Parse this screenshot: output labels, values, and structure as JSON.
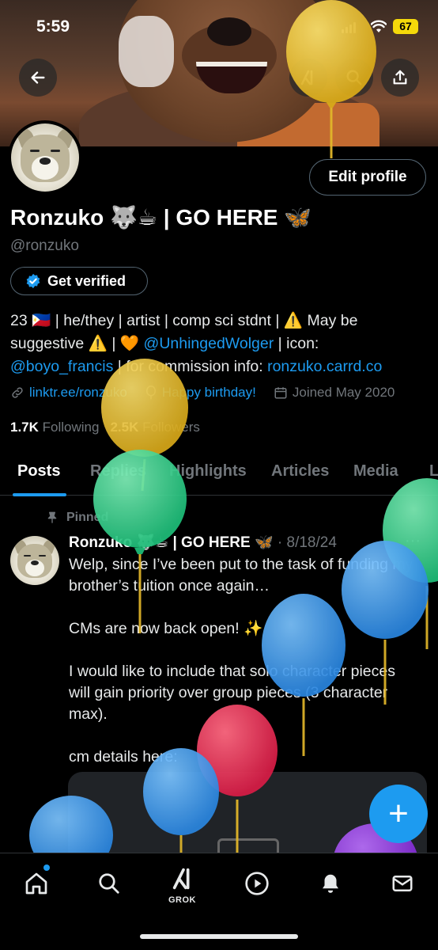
{
  "status": {
    "time": "5:59",
    "battery": "67"
  },
  "profile": {
    "display_name": "Ronzuko 🐺☕ | GO HERE 🦋",
    "handle": "@ronzuko",
    "edit_profile": "Edit profile",
    "get_verified": "Get verified",
    "bio_line1": "23 🇵🇭 | he/they | artist | comp sci stdnt | ⚠️ May be",
    "bio_line2_a": "suggestive ⚠️ | 🧡 ",
    "bio_mention1": "@UnhingedWolger",
    "bio_line2_b": " | icon:",
    "bio_mention2": "@boyo_francis",
    "bio_line3_b": " | for commission info: ",
    "bio_link": "ronzuko.carrd.co",
    "link": "linktr.ee/ronzuko",
    "birthday": "Happy birthday!",
    "joined": "Joined May 2020",
    "following_count": "1.7K",
    "following_label": "Following",
    "followers_count": "2.5K",
    "followers_label": "Followers"
  },
  "tabs": [
    "Posts",
    "Replies",
    "Highlights",
    "Articles",
    "Media",
    "L"
  ],
  "post": {
    "pinned_label": "Pinned",
    "author": "Ronzuko 🐺☕ | GO HERE 🦋",
    "date": "· 8/18/24",
    "more": "···",
    "paragraphs": [
      "Welp, since I’ve been put to the task of funding my brother’s tuition once again…",
      "CMs are now back open! ✨",
      "I would like to include that solo character pieces will gain priority over group pieces (3 character max).",
      "cm details here:"
    ]
  },
  "fab_label": "+",
  "nav": {
    "grok_label": "GROK"
  },
  "colors": {
    "accent": "#1d9bf0",
    "background": "#000000",
    "muted": "#71767b",
    "battery": "#f5d90a"
  },
  "icons": [
    "back-arrow-icon",
    "grok-icon",
    "search-icon",
    "share-icon",
    "verified-badge-icon",
    "link-icon",
    "balloon-icon",
    "calendar-icon",
    "pin-icon",
    "home-icon",
    "bell-icon",
    "mail-icon",
    "play-icon"
  ]
}
